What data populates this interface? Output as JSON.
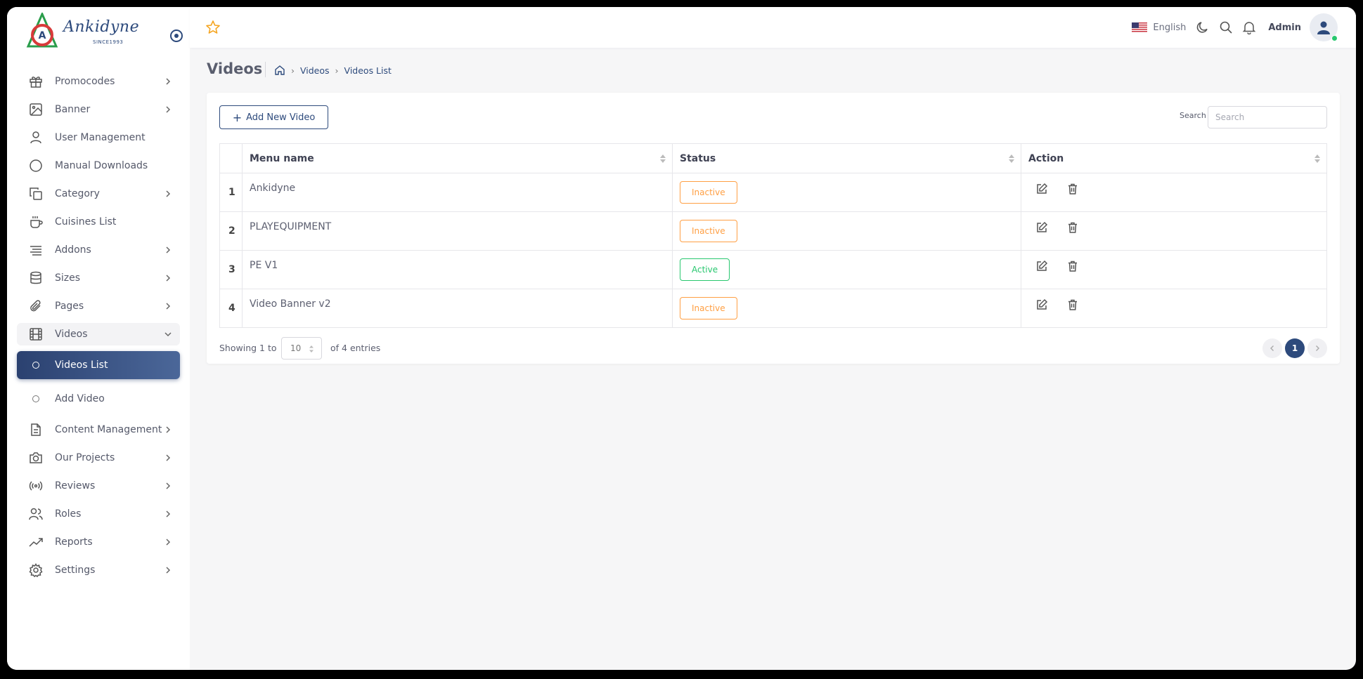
{
  "brand": {
    "name": "Ankidyne",
    "tagline": "SINCE1993"
  },
  "sidebar": {
    "items": [
      {
        "label": "Promocodes",
        "icon": "gift-icon",
        "has_children": true
      },
      {
        "label": "Banner",
        "icon": "image-icon",
        "has_children": true
      },
      {
        "label": "User Management",
        "icon": "user-icon",
        "has_children": false
      },
      {
        "label": "Manual Downloads",
        "icon": "circle-icon",
        "has_children": false
      },
      {
        "label": "Category",
        "icon": "copy-icon",
        "has_children": true
      },
      {
        "label": "Cuisines List",
        "icon": "coffee-icon",
        "has_children": false
      },
      {
        "label": "Addons",
        "icon": "list-icon",
        "has_children": true
      },
      {
        "label": "Sizes",
        "icon": "database-icon",
        "has_children": true
      },
      {
        "label": "Pages",
        "icon": "paperclip-icon",
        "has_children": true
      },
      {
        "label": "Videos",
        "icon": "film-icon",
        "has_children": true,
        "expanded": true
      },
      {
        "label": "Videos List",
        "icon": "circle-icon",
        "sub": true,
        "active": true
      },
      {
        "label": "Add Video",
        "icon": "circle-icon",
        "sub": true
      },
      {
        "label": "Content Management",
        "icon": "file-icon",
        "has_children": true
      },
      {
        "label": "Our Projects",
        "icon": "camera-icon",
        "has_children": true
      },
      {
        "label": "Reviews",
        "icon": "broadcast-icon",
        "has_children": true
      },
      {
        "label": "Roles",
        "icon": "users-icon",
        "has_children": true
      },
      {
        "label": "Reports",
        "icon": "trending-up-icon",
        "has_children": true
      },
      {
        "label": "Settings",
        "icon": "gear-icon",
        "has_children": true
      }
    ]
  },
  "topbar": {
    "language": "English",
    "user": "Admin"
  },
  "page": {
    "title": "Videos",
    "breadcrumb": [
      "Videos",
      "Videos List"
    ]
  },
  "toolbar": {
    "add_label": "Add New Video",
    "search_label": "Search",
    "search_placeholder": "Search"
  },
  "table": {
    "columns": [
      "Menu name",
      "Status",
      "Action"
    ],
    "rows": [
      {
        "num": "1",
        "name": "Ankidyne",
        "status": "Inactive"
      },
      {
        "num": "2",
        "name": "PLAYEQUIPMENT",
        "status": "Inactive"
      },
      {
        "num": "3",
        "name": "PE V1",
        "status": "Active"
      },
      {
        "num": "4",
        "name": "Video Banner v2",
        "status": "Inactive"
      }
    ]
  },
  "footer": {
    "showing": "Showing 1 to",
    "page_size": "10",
    "of_entries": "of 4 entries",
    "current_page": "1"
  },
  "colors": {
    "primary": "#2d4a7c",
    "inactive": "#ff9f43",
    "active": "#28c76f"
  }
}
